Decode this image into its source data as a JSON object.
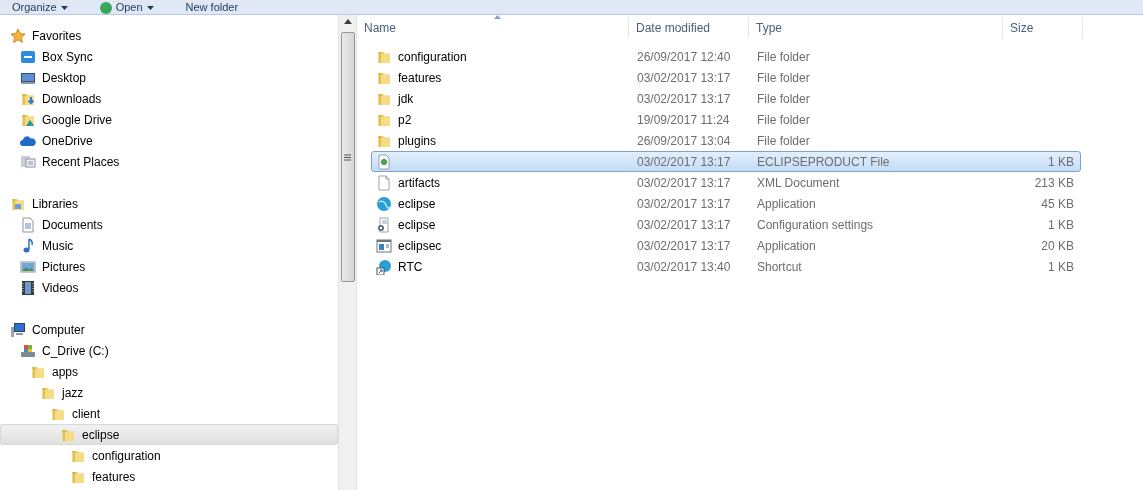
{
  "toolbar": {
    "buttons": [
      {
        "label": "Organize",
        "dropdown": true,
        "kind": "plain"
      },
      {
        "label": "Open",
        "dropdown": true,
        "kind": "app"
      },
      {
        "label": "New folder",
        "dropdown": false,
        "kind": "plain"
      }
    ]
  },
  "navigation": {
    "groups": [
      {
        "label": "Favorites",
        "kind": "star",
        "selected": false,
        "children": [
          {
            "label": "Box Sync",
            "kind": "box",
            "selected": false
          },
          {
            "label": "Desktop",
            "kind": "desktop",
            "selected": false
          },
          {
            "label": "Downloads",
            "kind": "downloads",
            "selected": false
          },
          {
            "label": "Google Drive",
            "kind": "gdrive",
            "selected": false
          },
          {
            "label": "OneDrive",
            "kind": "cloud",
            "selected": false
          },
          {
            "label": "Recent Places",
            "kind": "recent",
            "selected": false
          }
        ]
      },
      {
        "label": "Libraries",
        "kind": "library",
        "selected": false,
        "children": [
          {
            "label": "Documents",
            "kind": "documents",
            "selected": false
          },
          {
            "label": "Music",
            "kind": "music",
            "selected": false
          },
          {
            "label": "Pictures",
            "kind": "pictures",
            "selected": false
          },
          {
            "label": "Videos",
            "kind": "videos",
            "selected": false
          }
        ]
      },
      {
        "label": "Computer",
        "kind": "computer",
        "selected": false,
        "children": [
          {
            "label": "C_Drive (C:)",
            "kind": "drive",
            "selected": false,
            "children": [
              {
                "label": "apps",
                "kind": "folder",
                "selected": false,
                "children": [
                  {
                    "label": "jazz",
                    "kind": "folder",
                    "selected": false,
                    "children": [
                      {
                        "label": "client",
                        "kind": "folder",
                        "selected": false,
                        "children": [
                          {
                            "label": "eclipse",
                            "kind": "folder",
                            "selected": true,
                            "children": [
                              {
                                "label": "configuration",
                                "kind": "folder",
                                "selected": false
                              },
                              {
                                "label": "features",
                                "kind": "folder",
                                "selected": false
                              }
                            ]
                          }
                        ]
                      }
                    ]
                  }
                ]
              }
            ]
          }
        ]
      }
    ]
  },
  "file_list": {
    "columns": [
      "Name",
      "Date modified",
      "Type",
      "Size"
    ],
    "rows": [
      {
        "name": "configuration",
        "date": "26/09/2017 12:40",
        "type": "File folder",
        "kind": "folder",
        "selected": false
      },
      {
        "name": "features",
        "date": "03/02/2017 13:17",
        "type": "File folder",
        "kind": "folder",
        "selected": false
      },
      {
        "name": "jdk",
        "date": "03/02/2017 13:17",
        "type": "File folder",
        "kind": "folder",
        "selected": false
      },
      {
        "name": "p2",
        "date": "19/09/2017 11:24",
        "type": "File folder",
        "kind": "folder",
        "selected": false
      },
      {
        "name": "plugins",
        "date": "26/09/2017 13:04",
        "type": "File folder",
        "kind": "folder",
        "selected": false
      },
      {
        "date": "03/02/2017 13:17",
        "type": "ECLIPSEPRODUCT File",
        "size": "1 KB",
        "kind": "product",
        "selected": true
      },
      {
        "name": "artifacts",
        "date": "03/02/2017 13:17",
        "type": "XML Document",
        "size": "213 KB",
        "kind": "blank",
        "selected": false
      },
      {
        "name": "eclipse",
        "date": "03/02/2017 13:17",
        "type": "Application",
        "size": "45 KB",
        "kind": "globe",
        "selected": false
      },
      {
        "name": "eclipse",
        "date": "03/02/2017 13:17",
        "type": "Configuration settings",
        "size": "1 KB",
        "kind": "config",
        "selected": false
      },
      {
        "name": "eclipsec",
        "date": "03/02/2017 13:17",
        "type": "Application",
        "size": "20 KB",
        "kind": "console",
        "selected": false
      },
      {
        "name": "RTC",
        "date": "03/02/2017 13:40",
        "type": "Shortcut",
        "size": "1 KB",
        "kind": "shortcut",
        "selected": false
      }
    ]
  }
}
